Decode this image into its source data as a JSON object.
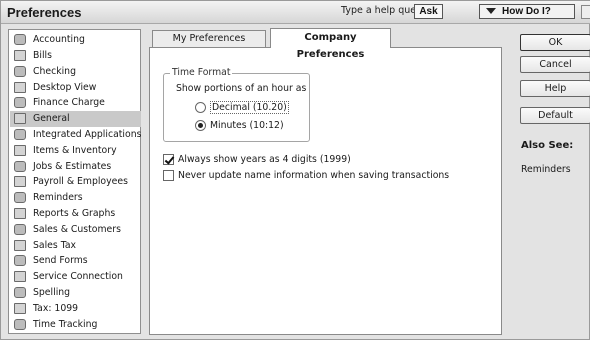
{
  "window": {
    "title": "Preferences",
    "help_question": "Type a help question",
    "ask_label": "Ask",
    "how_do_i_label": "How Do I?"
  },
  "preferences_list": [
    {
      "label": "Accounting",
      "icon": "accounting-icon"
    },
    {
      "label": "Bills",
      "icon": "bills-icon"
    },
    {
      "label": "Checking",
      "icon": "checking-icon"
    },
    {
      "label": "Desktop View",
      "icon": "desktop-view-icon"
    },
    {
      "label": "Finance Charge",
      "icon": "finance-charge-icon"
    },
    {
      "label": "General",
      "icon": "general-icon",
      "selected": true
    },
    {
      "label": "Integrated Applications",
      "icon": "integrated-applications-icon"
    },
    {
      "label": "Items & Inventory",
      "icon": "items-inventory-icon"
    },
    {
      "label": "Jobs & Estimates",
      "icon": "jobs-estimates-icon"
    },
    {
      "label": "Payroll & Employees",
      "icon": "payroll-employees-icon"
    },
    {
      "label": "Reminders",
      "icon": "reminders-icon"
    },
    {
      "label": "Reports & Graphs",
      "icon": "reports-graphs-icon"
    },
    {
      "label": "Sales & Customers",
      "icon": "sales-customers-icon"
    },
    {
      "label": "Sales Tax",
      "icon": "sales-tax-icon"
    },
    {
      "label": "Send Forms",
      "icon": "send-forms-icon"
    },
    {
      "label": "Service Connection",
      "icon": "service-connection-icon"
    },
    {
      "label": "Spelling",
      "icon": "spelling-icon"
    },
    {
      "label": "Tax: 1099",
      "icon": "tax-1099-icon"
    },
    {
      "label": "Time Tracking",
      "icon": "time-tracking-icon"
    }
  ],
  "tabs": [
    {
      "label": "My Preferences",
      "active": false
    },
    {
      "label": "Company Preferences",
      "active": true
    }
  ],
  "time_format": {
    "legend": "Time Format",
    "prompt": "Show portions of an hour as",
    "options": [
      {
        "label": "Decimal (10.20)",
        "selected": false
      },
      {
        "label": "Minutes (10:12)",
        "selected": true
      }
    ]
  },
  "checkboxes": [
    {
      "label": "Always show years as 4 digits (1999)",
      "checked": true
    },
    {
      "label": "Never update name information when saving transactions",
      "checked": false
    }
  ],
  "buttons": {
    "ok": "OK",
    "cancel": "Cancel",
    "help": "Help",
    "default": "Default"
  },
  "also_see": {
    "title": "Also See:",
    "links": [
      "Reminders"
    ]
  }
}
